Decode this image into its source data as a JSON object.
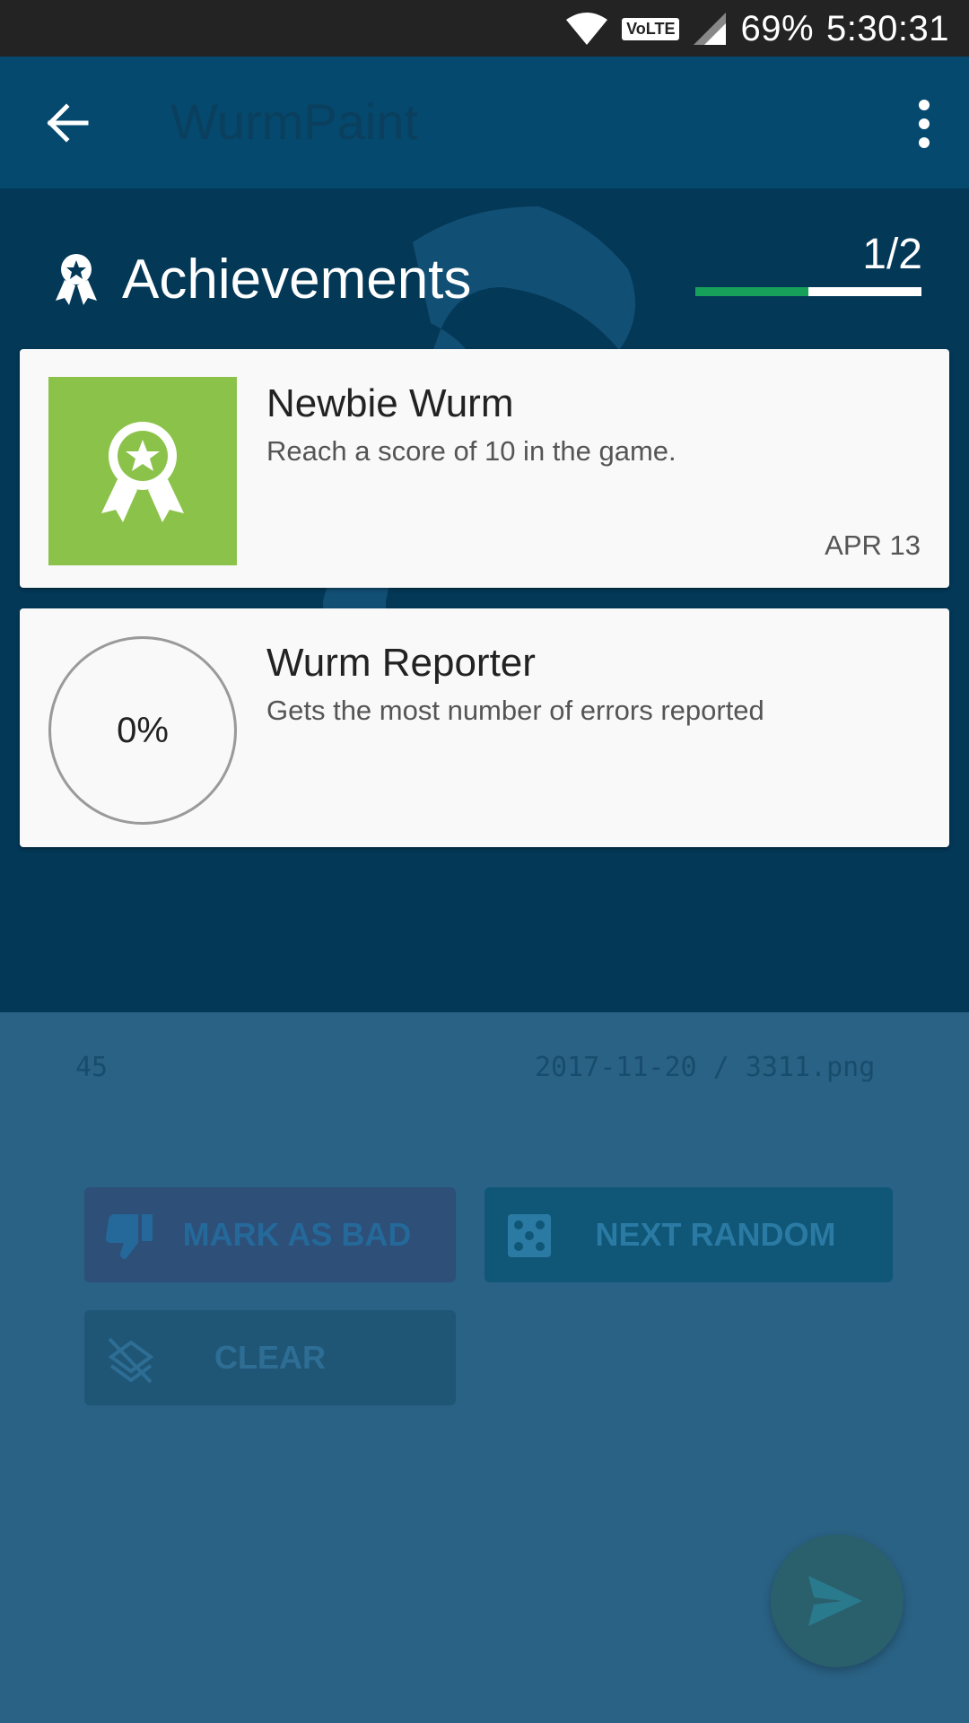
{
  "status_bar": {
    "network": "VoLTE",
    "battery": "69%",
    "time": "5:30:31"
  },
  "app_bar": {
    "title": "WurmPaint"
  },
  "achievements": {
    "title": "Achievements",
    "count": "1/2",
    "progress_fraction": 0.5,
    "items": [
      {
        "name": "Newbie Wurm",
        "description": "Reach a score of 10 in the game.",
        "date": "APR 13",
        "unlocked": true,
        "icon": "award-ribbon-icon"
      },
      {
        "name": "Wurm Reporter",
        "description": "Gets the most number of errors reported",
        "progress_label": "0%",
        "unlocked": false
      }
    ]
  },
  "background": {
    "score": "45",
    "file": "2017-11-20 / 3311.png",
    "buttons": {
      "mark_bad": "MARK AS BAD",
      "next_random": "NEXT RANDOM",
      "clear": "CLEAR"
    }
  },
  "colors": {
    "app_bar": "#05496e",
    "panel": "#033857",
    "badge": "#8bc34a",
    "progress": "#16a05a"
  }
}
